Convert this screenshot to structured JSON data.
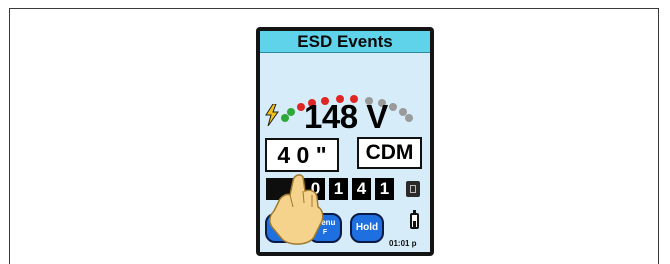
{
  "screen": {
    "title": "ESD Events",
    "voltage": "148 V",
    "distance": "4 0 \"",
    "mode": "CDM",
    "counter_digits": [
      "0",
      "1",
      "4",
      "1"
    ],
    "clock": "01:01 p"
  },
  "gauge": {
    "dots": [
      "green",
      "green",
      "red",
      "red",
      "red",
      "red",
      "red",
      "grey",
      "grey",
      "grey",
      "grey",
      "grey"
    ]
  },
  "buttons": [
    {
      "line1": "Reset",
      "line2": "C"
    },
    {
      "line1": "Menu",
      "line2": "F"
    },
    {
      "label": "Hold"
    }
  ],
  "icons": {
    "bolt": "lightning-bolt-icon",
    "battery": "battery-icon",
    "small": "display-icon",
    "pointer": "hand-pointer-icon"
  },
  "colors": {
    "title_bar": "#5fd3ea",
    "screen_bg": "#d6ecf9",
    "button": "#1e6fe0",
    "led_green": "#2fa83a",
    "led_red": "#e02525",
    "led_off": "#9a9a9a"
  }
}
